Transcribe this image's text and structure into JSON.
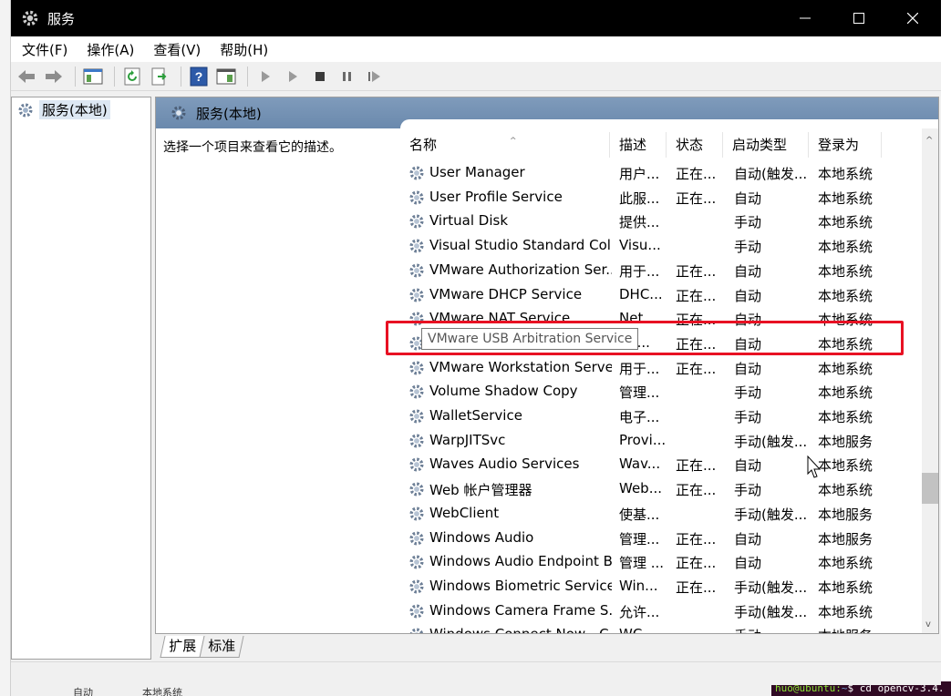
{
  "window": {
    "title": "服务",
    "controls": {
      "minimize": "─",
      "maximize": "☐",
      "close": "✕"
    }
  },
  "menu": [
    "文件(F)",
    "操作(A)",
    "查看(V)",
    "帮助(H)"
  ],
  "toolbar": {
    "icons": [
      "back-arrow-icon",
      "forward-arrow-icon",
      "console-tree-icon",
      "refresh-icon",
      "export-list-icon",
      "help-icon",
      "properties-icon",
      "start-service-icon",
      "start-service-alt-icon",
      "stop-service-icon",
      "pause-service-icon",
      "restart-service-icon"
    ]
  },
  "tree": {
    "root_label": "服务(本地)"
  },
  "panel": {
    "header": "服务(本地)",
    "description_hint": "选择一个项目来查看它的描述。"
  },
  "columns": [
    "名称",
    "描述",
    "状态",
    "启动类型",
    "登录为"
  ],
  "rows": [
    {
      "name": "User Manager",
      "desc": "用户...",
      "state": "正在...",
      "start": "自动(触发...",
      "login": "本地系统"
    },
    {
      "name": "User Profile Service",
      "desc": "此服...",
      "state": "正在...",
      "start": "自动",
      "login": "本地系统"
    },
    {
      "name": "Virtual Disk",
      "desc": "提供...",
      "state": "",
      "start": "手动",
      "login": "本地系统"
    },
    {
      "name": "Visual Studio Standard Coll...",
      "desc": "Visu...",
      "state": "",
      "start": "手动",
      "login": "本地系统"
    },
    {
      "name": "VMware Authorization Ser...",
      "desc": "用于...",
      "state": "正在...",
      "start": "自动",
      "login": "本地系统"
    },
    {
      "name": "VMware DHCP Service",
      "desc": "DHC...",
      "state": "正在...",
      "start": "自动",
      "login": "本地系统"
    },
    {
      "name": "VMware NAT Service",
      "desc": "Net...",
      "state": "正在...",
      "start": "自动",
      "login": "本地系统"
    },
    {
      "name": "VMware USB Arbitration Service",
      "desc": "bit...",
      "state": "正在...",
      "start": "自动",
      "login": "本地系统"
    },
    {
      "name": "VMware Workstation Server",
      "desc": "用于...",
      "state": "正在...",
      "start": "自动",
      "login": "本地系统"
    },
    {
      "name": "Volume Shadow Copy",
      "desc": "管理...",
      "state": "",
      "start": "手动",
      "login": "本地系统"
    },
    {
      "name": "WalletService",
      "desc": "电子...",
      "state": "",
      "start": "手动",
      "login": "本地系统"
    },
    {
      "name": "WarpJITSvc",
      "desc": "Provi...",
      "state": "",
      "start": "手动(触发...",
      "login": "本地服务"
    },
    {
      "name": "Waves Audio Services",
      "desc": "Wav...",
      "state": "正在...",
      "start": "自动",
      "login": "本地系统"
    },
    {
      "name": "Web 帐户管理器",
      "desc": "Web...",
      "state": "正在...",
      "start": "手动",
      "login": "本地系统"
    },
    {
      "name": "WebClient",
      "desc": "使基...",
      "state": "",
      "start": "手动(触发...",
      "login": "本地服务"
    },
    {
      "name": "Windows Audio",
      "desc": "管理...",
      "state": "正在...",
      "start": "自动",
      "login": "本地服务"
    },
    {
      "name": "Windows Audio Endpoint B...",
      "desc": "管理 ...",
      "state": "正在...",
      "start": "自动",
      "login": "本地系统"
    },
    {
      "name": "Windows Biometric Service",
      "desc": "Win...",
      "state": "正在...",
      "start": "手动(触发...",
      "login": "本地系统"
    },
    {
      "name": "Windows Camera Frame S...",
      "desc": "允许...",
      "state": "",
      "start": "手动(触发...",
      "login": "本地系统"
    },
    {
      "name": "Windows Connect Now - C...",
      "desc": "WC...",
      "state": "",
      "start": "手动",
      "login": "本地服务"
    }
  ],
  "tooltip": "VMware USB Arbitration Service",
  "tabs": [
    "扩展",
    "标准"
  ],
  "background": {
    "bottom_start": "自动",
    "bottom_login": "本地系统",
    "terminal_prompt": "huo@ubuntu:",
    "terminal_path": "~",
    "terminal_cmd": "$ cd opencv-3.4."
  }
}
